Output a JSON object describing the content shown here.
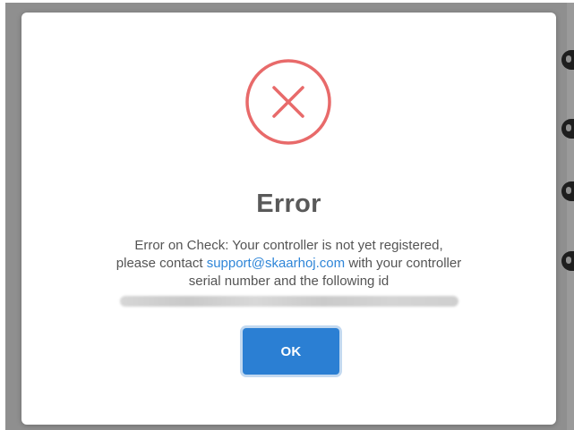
{
  "dialog": {
    "title": "Error",
    "message_line1": "Error on Check: Your controller is not yet registered,",
    "message_line2_prefix": "please contact ",
    "support_email": "support@skaarhoj.com",
    "message_line2_suffix": " with your controller",
    "message_line3": "serial number and the following id",
    "ok_label": "OK",
    "icon": "error-circle-x-icon"
  },
  "colors": {
    "error_red": "#e86a6a",
    "button_blue": "#2b7fd3",
    "link_blue": "#2f86d8"
  }
}
